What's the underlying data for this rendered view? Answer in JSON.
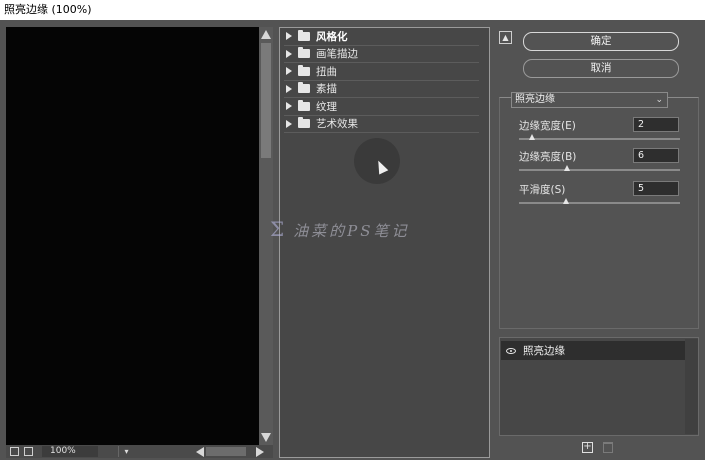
{
  "window": {
    "title": "照亮边缘 (100%)"
  },
  "preview": {
    "zoom": "100%"
  },
  "gallery": {
    "categories": [
      {
        "label": "风格化",
        "bold": true
      },
      {
        "label": "画笔描边",
        "bold": false
      },
      {
        "label": "扭曲",
        "bold": false
      },
      {
        "label": "素描",
        "bold": false
      },
      {
        "label": "纹理",
        "bold": false
      },
      {
        "label": "艺术效果",
        "bold": false
      }
    ]
  },
  "actions": {
    "ok_label": "确定",
    "cancel_label": "取消"
  },
  "filter": {
    "selected": "照亮边缘",
    "params": [
      {
        "label": "边缘宽度(E)",
        "value": "2",
        "fraction": 0.08
      },
      {
        "label": "边缘亮度(B)",
        "value": "6",
        "fraction": 0.3
      },
      {
        "label": "平滑度(S)",
        "value": "5",
        "fraction": 0.29
      }
    ]
  },
  "layers": {
    "items": [
      {
        "name": "照亮边缘"
      }
    ]
  },
  "watermark": {
    "text": "油菜的PS笔记"
  }
}
